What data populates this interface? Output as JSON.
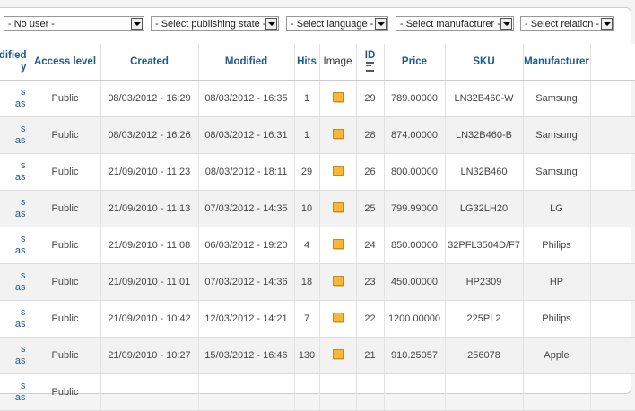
{
  "filters": {
    "user": "- No user -",
    "publishing_state": "- Select publishing state -",
    "language": "- Select language -",
    "manufacturer": "- Select manufacturer -",
    "relation": "- Select relation -"
  },
  "columns": {
    "modified_by": "odified\ny",
    "access_level": "Access level",
    "created": "Created",
    "modified": "Modified",
    "hits": "Hits",
    "image": "Image",
    "id": "ID",
    "price": "Price",
    "sku": "SKU",
    "manufacturer": "Manufacturer"
  },
  "rows": [
    {
      "author_a": "s",
      "author_b": "as",
      "access": "Public",
      "created": "08/03/2012 - 16:29",
      "modified": "08/03/2012 - 16:35",
      "hits": "1",
      "id": "29",
      "price": "789.00000",
      "sku": "LN32B460-W",
      "manufacturer": "Samsung"
    },
    {
      "author_a": "s",
      "author_b": "as",
      "access": "Public",
      "created": "08/03/2012 - 16:26",
      "modified": "08/03/2012 - 16:31",
      "hits": "1",
      "id": "28",
      "price": "874.00000",
      "sku": "LN32B460-B",
      "manufacturer": "Samsung"
    },
    {
      "author_a": "s",
      "author_b": "as",
      "access": "Public",
      "created": "21/09/2010 - 11:23",
      "modified": "08/03/2012 - 18:11",
      "hits": "29",
      "id": "26",
      "price": "800.00000",
      "sku": "LN32B460",
      "manufacturer": "Samsung"
    },
    {
      "author_a": "s",
      "author_b": "as",
      "access": "Public",
      "created": "21/09/2010 - 11:13",
      "modified": "07/03/2012 - 14:35",
      "hits": "10",
      "id": "25",
      "price": "799.99000",
      "sku": "LG32LH20",
      "manufacturer": "LG"
    },
    {
      "author_a": "s",
      "author_b": "as",
      "access": "Public",
      "created": "21/09/2010 - 11:08",
      "modified": "06/03/2012 - 19:20",
      "hits": "4",
      "id": "24",
      "price": "850.00000",
      "sku": "32PFL3504D/F7",
      "manufacturer": "Philips"
    },
    {
      "author_a": "s",
      "author_b": "as",
      "access": "Public",
      "created": "21/09/2010 - 11:01",
      "modified": "07/03/2012 - 14:36",
      "hits": "18",
      "id": "23",
      "price": "450.00000",
      "sku": "HP2309",
      "manufacturer": "HP"
    },
    {
      "author_a": "s",
      "author_b": "as",
      "access": "Public",
      "created": "21/09/2010 - 10:42",
      "modified": "12/03/2012 - 14:21",
      "hits": "7",
      "id": "22",
      "price": "1200.00000",
      "sku": "225PL2",
      "manufacturer": "Philips"
    },
    {
      "author_a": "s",
      "author_b": "as",
      "access": "Public",
      "created": "21/09/2010 - 10:27",
      "modified": "15/03/2012 - 16:46",
      "hits": "130",
      "id": "21",
      "price": "910.25057",
      "sku": "256078",
      "manufacturer": "Apple"
    },
    {
      "author_a": "s",
      "author_b": "as",
      "access": "Public",
      "created": "",
      "modified": "",
      "hits": "",
      "id": "",
      "price": "",
      "sku": "",
      "manufacturer": ""
    }
  ]
}
